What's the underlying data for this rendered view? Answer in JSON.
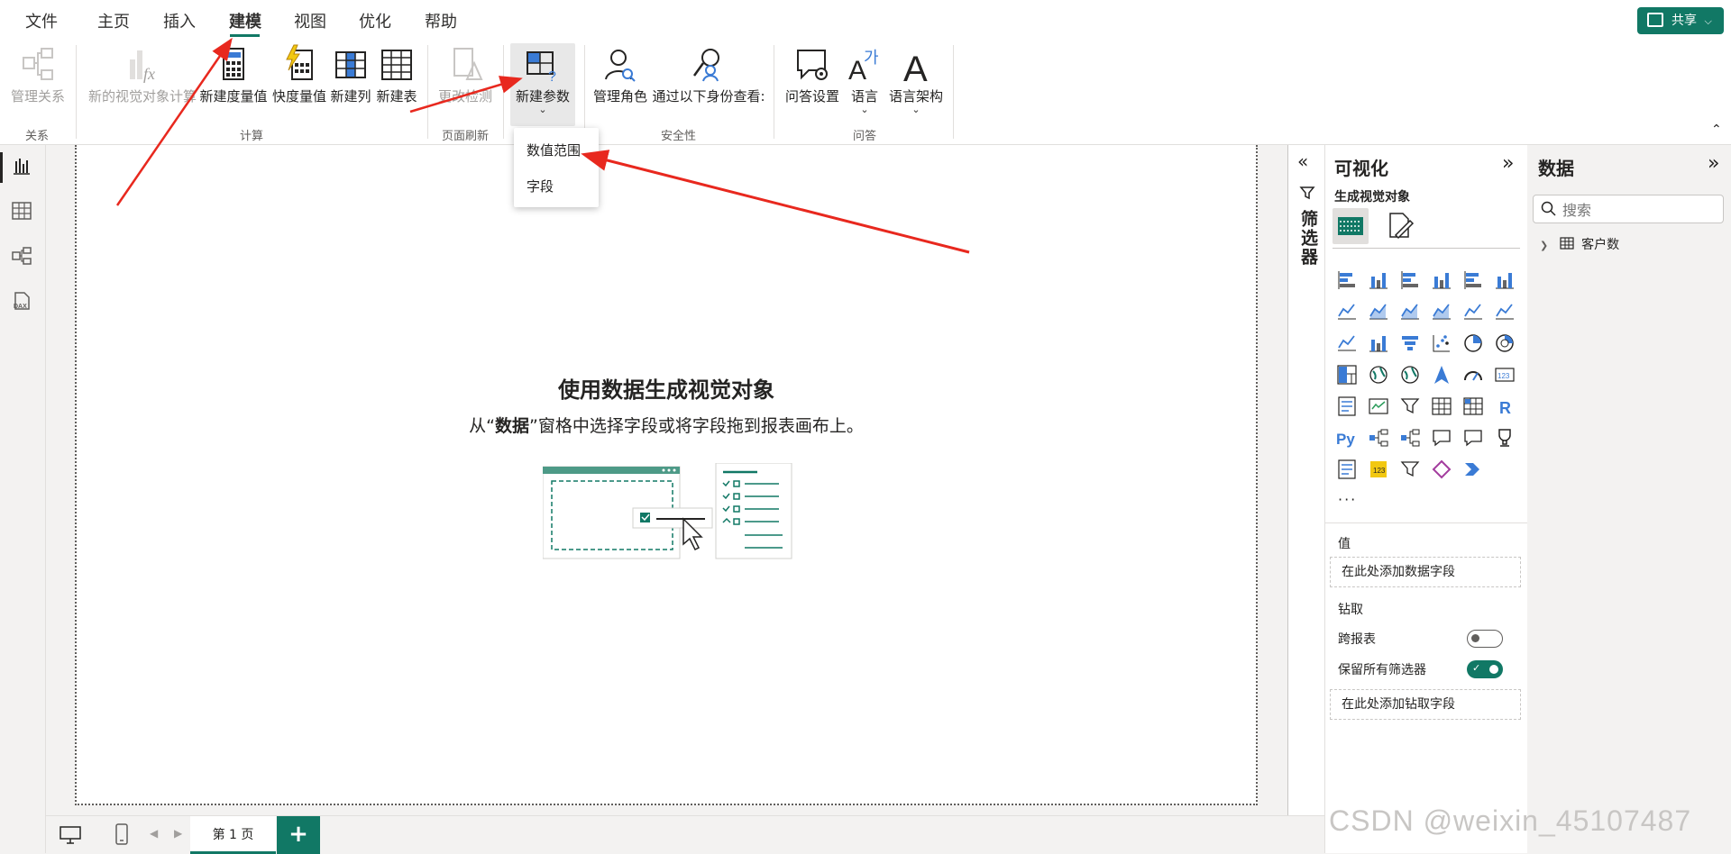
{
  "menu": {
    "items": [
      "文件",
      "主页",
      "插入",
      "建模",
      "视图",
      "优化",
      "帮助"
    ],
    "active": "建模",
    "share_label": "共享"
  },
  "ribbon": {
    "buttons": {
      "manage_relationships": "管理关系",
      "new_visual_calc": "新的视觉对象计算",
      "new_measure": "新建度量值",
      "quick_measure": "快度量值",
      "new_column": "新建列",
      "new_table": "新建表",
      "change_detection": "更改检测",
      "new_parameter": "新建参数",
      "manage_roles": "管理角色",
      "view_as": "通过以下身份查看:",
      "qa_setup": "问答设置",
      "language": "语言",
      "linguistic_schema": "语言架构"
    },
    "groups": {
      "relationships": "关系",
      "calculations": "计算",
      "page_refresh": "页面刷新",
      "security": "安全性",
      "qa": "问答"
    }
  },
  "dropdown": {
    "items": [
      "数值范围",
      "字段"
    ]
  },
  "canvas": {
    "title": "使用数据生成视觉对象",
    "desc_prefix": "从“",
    "desc_bold": "数据",
    "desc_suffix": "”窗格中选择字段或将字段拖到报表画布上。"
  },
  "pages": {
    "tab_label": "第 1 页",
    "add_label": "+"
  },
  "filter_pane": {
    "label": "筛选器"
  },
  "viz_pane": {
    "title": "可视化",
    "subtitle": "生成视觉对象",
    "more": "···",
    "values_label": "值",
    "values_placeholder": "在此处添加数据字段",
    "drill_label": "钻取",
    "cross_report_label": "跨报表",
    "cross_report_on": false,
    "keep_filters_label": "保留所有筛选器",
    "keep_filters_on": true,
    "drill_placeholder": "在此处添加钻取字段"
  },
  "data_pane": {
    "title": "数据",
    "search_placeholder": "搜索",
    "tables": [
      "客户数"
    ]
  },
  "colors": {
    "accent": "#117865",
    "arrow": "#e8281e"
  },
  "watermark": "CSDN @weixin_45107487"
}
